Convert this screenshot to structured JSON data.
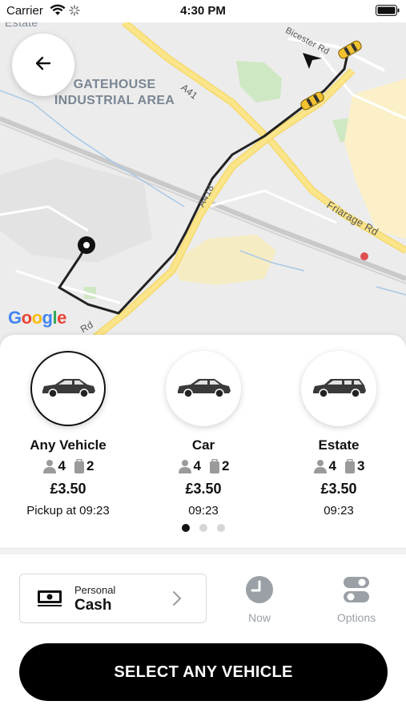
{
  "status_bar": {
    "carrier": "Carrier",
    "time": "4:30 PM"
  },
  "map": {
    "area_label": "GATEHOUSE INDUSTRIAL AREA",
    "top_cut_label": "Estate",
    "roads": {
      "bicester": "Bicester Rd",
      "a41": "A41",
      "a418": "A418",
      "friarage": "Friarage Rd",
      "rd": "Rd"
    },
    "google_logo": "Google",
    "route_color": "#222222",
    "accent_yellow": "#f7d94a"
  },
  "vehicles": [
    {
      "name": "Any Vehicle",
      "passengers": "4",
      "luggage": "2",
      "price": "£3.50",
      "eta": "Pickup at 09:23",
      "selected": true,
      "icon": "car-sedan-icon"
    },
    {
      "name": "Car",
      "passengers": "4",
      "luggage": "2",
      "price": "£3.50",
      "eta": "09:23",
      "selected": false,
      "icon": "car-sedan-icon"
    },
    {
      "name": "Estate",
      "passengers": "4",
      "luggage": "3",
      "price": "£3.50",
      "eta": "09:23",
      "selected": false,
      "icon": "car-estate-icon"
    }
  ],
  "pager": {
    "count": 3,
    "active": 1
  },
  "payment": {
    "type": "Personal",
    "method": "Cash",
    "icon": "cash-icon"
  },
  "now": {
    "label": "Now",
    "icon": "clock-icon"
  },
  "options": {
    "label": "Options",
    "icon": "toggle-icon"
  },
  "cta": {
    "label": "SELECT ANY VEHICLE",
    "color": "#000000"
  }
}
